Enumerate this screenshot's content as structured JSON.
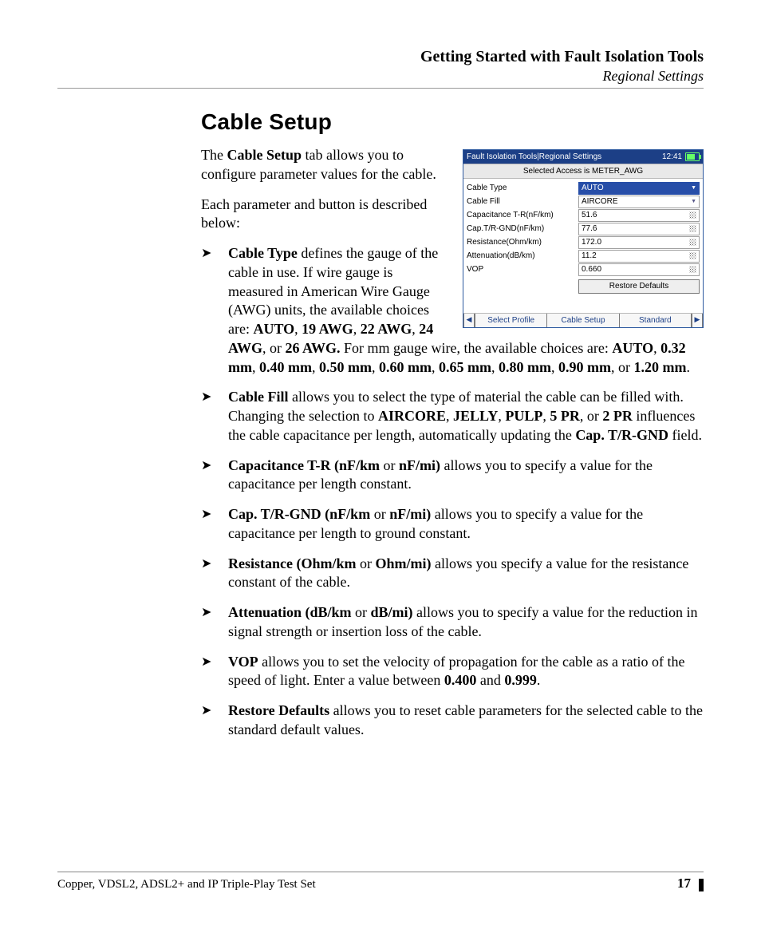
{
  "header": {
    "title": "Getting Started with Fault Isolation Tools",
    "subtitle": "Regional Settings"
  },
  "section_heading": "Cable Setup",
  "intro": {
    "p1_pre": "The ",
    "p1_bold": "Cable Setup",
    "p1_post": " tab allows you to configure parameter values for the cable.",
    "p2": "Each parameter and button is described below:"
  },
  "bullets": {
    "b1": {
      "lead": "Cable Type",
      "t1": " defines the gauge of the cable in use. If wire gauge is measured in American Wire Gauge (AWG) units, the available choices are: ",
      "awg1": "AUTO",
      "awg2": "19 AWG",
      "awg3": "22 AWG",
      "awg4": "24 AWG",
      "awg5": "26 AWG.",
      "t2": " For mm gauge wire, the available choices are: ",
      "mm1": "AUTO",
      "mm2": "0.32 mm",
      "mm3": "0.40 mm",
      "mm4": "0.50 mm",
      "mm5": "0.60 mm",
      "mm6": "0.65 mm",
      "mm7": "0.80 mm",
      "mm8": "0.90 mm",
      "mm9": "1.20 mm"
    },
    "b2": {
      "lead": "Cable Fill",
      "t1": " allows you to select the type of material the cable can be filled with. Changing the selection to ",
      "o1": "AIRCORE",
      "o2": "JELLY",
      "o3": "PULP",
      "o4": "5 PR",
      "o5": "2 PR",
      "t2": " influences the cable capacitance per length, automatically updating the ",
      "fld": "Cap. T/R-GND",
      "t3": " field."
    },
    "b3": {
      "lead": "Capacitance T-R (nF/km",
      "unit_or": " or ",
      "unit2": "nF/mi)",
      "t1": " allows you to specify a value for the capacitance per length constant."
    },
    "b4": {
      "lead": "Cap. T/R-GND (nF/km",
      "unit_or": " or ",
      "unit2": "nF/mi)",
      "t1": " allows you to specify a value for the capacitance per length to ground constant."
    },
    "b5": {
      "lead": "Resistance (Ohm/km",
      "unit_or": " or ",
      "unit2": "Ohm/mi)",
      "t1": " allows you specify a value for the resistance constant of the cable."
    },
    "b6": {
      "lead": "Attenuation (dB/km",
      "unit_or": " or ",
      "unit2": "dB/mi)",
      "t1": " allows you to specify a value for the reduction in signal strength or insertion loss of the cable."
    },
    "b7": {
      "lead": "VOP",
      "t1": " allows you to set the velocity of propagation for the cable as a ratio of the speed of light. Enter a value between ",
      "v1": "0.400",
      "and": " and ",
      "v2": "0.999",
      "t2": "."
    },
    "b8": {
      "lead": "Restore Defaults",
      "t1": " allows you to reset cable parameters for the selected cable to the standard default values."
    }
  },
  "screenshot": {
    "titlebar": {
      "left": "Fault Isolation Tools|Regional Settings",
      "clock": "12:41"
    },
    "selected_access": "Selected Access  is METER_AWG",
    "rows": [
      {
        "label": "Cable Type",
        "value": "AUTO",
        "kind": "dropdown",
        "selected": true
      },
      {
        "label": "Cable Fill",
        "value": "AIRCORE",
        "kind": "dropdown",
        "selected": false
      },
      {
        "label": "Capacitance T-R(nF/km)",
        "value": "51.6",
        "kind": "numeric",
        "selected": false
      },
      {
        "label": "Cap.T/R-GND(nF/km)",
        "value": "77.6",
        "kind": "numeric",
        "selected": false
      },
      {
        "label": "Resistance(Ohm/km)",
        "value": "172.0",
        "kind": "numeric",
        "selected": false
      },
      {
        "label": "Attenuation(dB/km)",
        "value": "11.2",
        "kind": "numeric",
        "selected": false
      },
      {
        "label": "VOP",
        "value": "0.660",
        "kind": "numeric",
        "selected": false
      }
    ],
    "restore_button": "Restore Defaults",
    "tabs": [
      "Select Profile",
      "Cable Setup",
      "Standard"
    ]
  },
  "footer": {
    "left": "Copper, VDSL2, ADSL2+ and IP Triple-Play Test Set",
    "page": "17"
  },
  "glyphs": {
    "comma_sep": ", ",
    "or_sep": ", or "
  }
}
